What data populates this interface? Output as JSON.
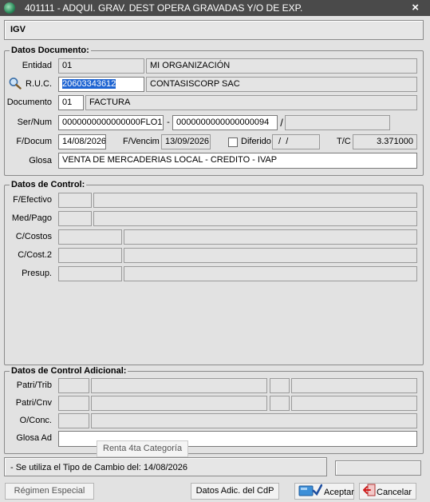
{
  "window": {
    "title": "401111 - ADQUI. GRAV. DEST OPERA GRAVADAS Y/O DE EXP."
  },
  "header": {
    "tax_code": "IGV"
  },
  "datos_documento": {
    "legend": "Datos Documento:",
    "entidad": {
      "label": "Entidad",
      "code": "01",
      "name": "MI ORGANIZACIÓN"
    },
    "ruc": {
      "label": "R.U.C.",
      "value": "20603343612",
      "name": "CONTASISCORP SAC"
    },
    "documento": {
      "label": "Documento",
      "code": "01",
      "name": "FACTURA"
    },
    "sernum": {
      "label": "Ser/Num",
      "serie": "0000000000000000FLO1",
      "dash": "-",
      "numero": "0000000000000000094",
      "slash": "/",
      "extra": ""
    },
    "fechas": {
      "fdocum_label": "F/Docum",
      "fdocum": "14/08/2026",
      "fvencim_label": "F/Vencim",
      "fvencim": "13/09/2026",
      "diferido_label": "Diferido",
      "diferido_value": " /  /",
      "tc_label": "T/C",
      "tc_value": "3.371000"
    },
    "glosa": {
      "label": "Glosa",
      "value": "VENTA DE MERCADERIAS LOCAL - CREDITO - IVAP"
    }
  },
  "datos_control": {
    "legend": "Datos de Control:",
    "rows": [
      {
        "label": "F/Efectivo",
        "code": "",
        "value": ""
      },
      {
        "label": "Med/Pago",
        "code": "",
        "value": ""
      },
      {
        "label": "C/Costos",
        "code": "",
        "value": ""
      },
      {
        "label": "C/Cost.2",
        "code": "",
        "value": ""
      },
      {
        "label": "Presup.",
        "code": "",
        "value": ""
      }
    ]
  },
  "datos_control_adicional": {
    "legend": "Datos de Control Adicional:",
    "patri_trib": {
      "label": "Patri/Trib"
    },
    "patri_cnv": {
      "label": "Patri/Cnv"
    },
    "oconc": {
      "label": "O/Conc."
    },
    "glosa_ad": {
      "label": "Glosa Ad",
      "value": ""
    }
  },
  "tooltip": "Renta 4ta Categoría",
  "status": {
    "message": "- Se utiliza el Tipo de Cambio del: 14/08/2026"
  },
  "footer": {
    "regimen_label": "Régimen Especial",
    "datos_adic_label": "Datos Adic. del CdP",
    "aceptar_label": "Aceptar",
    "cancelar_label": "Cancelar"
  }
}
